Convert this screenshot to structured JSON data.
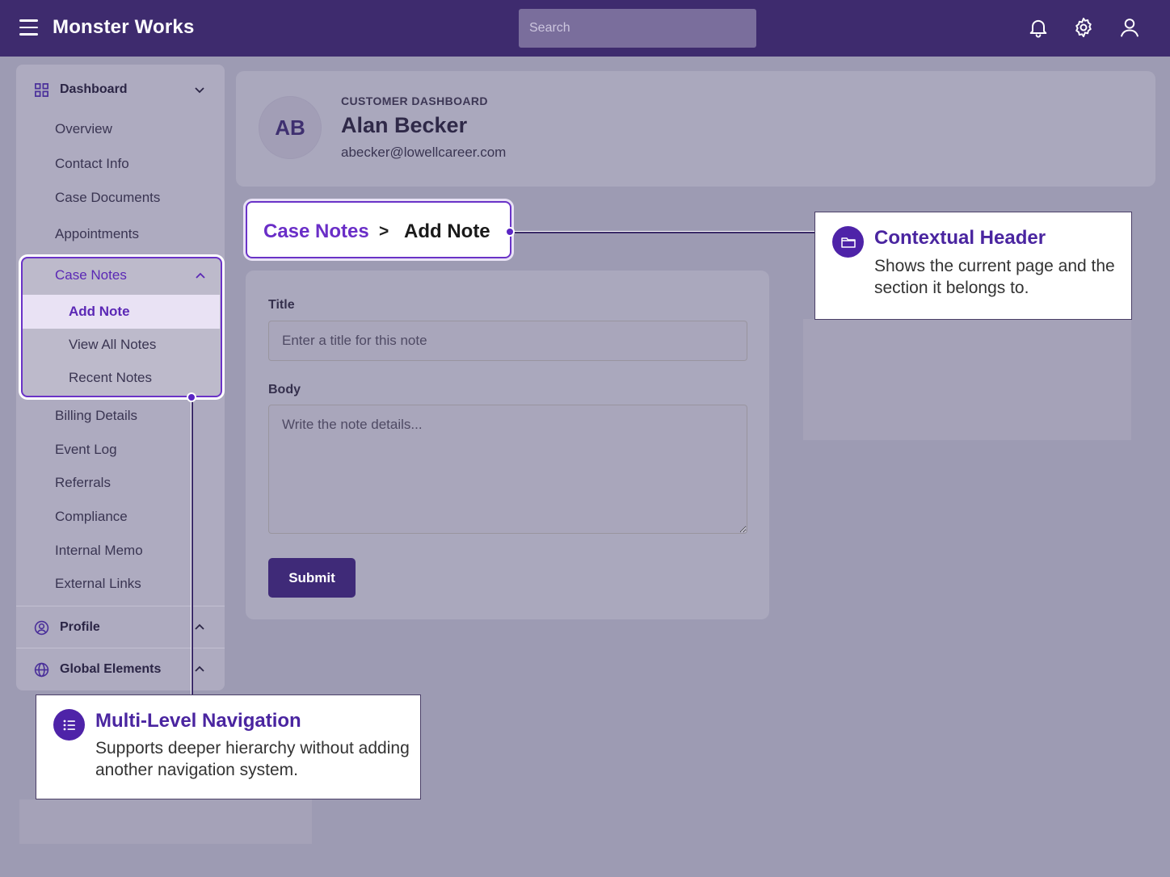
{
  "app": {
    "title": "Monster Works"
  },
  "search": {
    "placeholder": "Search"
  },
  "topbar_icons": [
    "bell-icon",
    "gear-icon",
    "user-icon"
  ],
  "sidebar": {
    "dashboard": {
      "label": "Dashboard",
      "items": [
        "Overview",
        "Contact Info",
        "Case Documents",
        "Appointments"
      ]
    },
    "case_notes": {
      "label": "Case Notes",
      "selected": "Add Note",
      "items": [
        "View All Notes",
        "Recent Notes"
      ]
    },
    "more_items": [
      "Billing Details",
      "Event Log",
      "Referrals",
      "Compliance",
      "Internal Memo",
      "External Links"
    ],
    "profile": {
      "label": "Profile"
    },
    "global": {
      "label": "Global Elements"
    }
  },
  "customer": {
    "eyebrow": "CUSTOMER DASHBOARD",
    "initials": "AB",
    "name": "Alan Becker",
    "email": "abecker@lowellcareer.com"
  },
  "breadcrumb": {
    "parent": "Case Notes",
    "separator": ">",
    "current": "Add Note"
  },
  "form": {
    "title_label": "Title",
    "title_placeholder": "Enter a title for this note",
    "body_label": "Body",
    "body_placeholder": "Write the note details...",
    "submit_label": "Submit"
  },
  "callouts": {
    "contextual_header": {
      "title": "Contextual Header",
      "body": "Shows the current page and the section it belongs to."
    },
    "multi_level_nav": {
      "title": "Multi-Level Navigation",
      "body": "Supports deeper hierarchy without adding another navigation system."
    }
  },
  "colors": {
    "topbar": "#3e2b6e",
    "accent": "#6a33c7",
    "submit": "#3f2a78"
  }
}
